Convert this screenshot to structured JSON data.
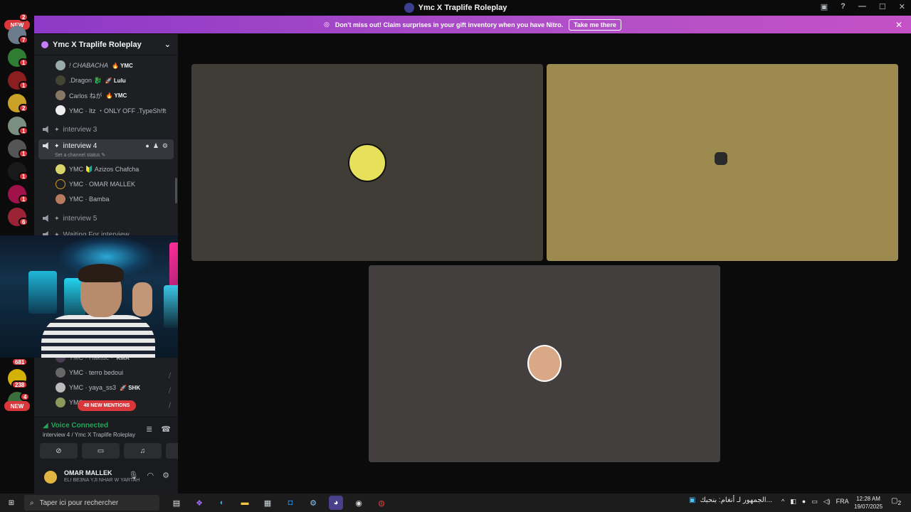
{
  "window": {
    "title": "Ymc X Traplife Roleplay",
    "help_icon": "?"
  },
  "nitro_banner": {
    "text": "Don't miss out! Claim surprises in your gift inventory when you have Nitro.",
    "button": "Take me there",
    "close": "✕"
  },
  "server_rail": {
    "top_new": "NEW",
    "badges": [
      "2",
      "7",
      "1",
      "1",
      "2",
      "1",
      "1",
      "1",
      "1",
      "6",
      "681",
      "238",
      "4"
    ],
    "bottom_new": "NEW"
  },
  "sidebar": {
    "server_name": "Ymc X Traplife Roleplay",
    "users_top": [
      {
        "name": "! CHABACHA",
        "tag": "🔥 YMC"
      },
      {
        "name": ".Dragon 🐉",
        "tag": "🚀 Lulu"
      },
      {
        "name": "Carlos ねが",
        "tag": "🔥 YMC"
      },
      {
        "name": "YMC · Itz ・ONLY OFF .TypeSh!ft",
        "tag": ""
      }
    ],
    "channels": [
      {
        "name": "interview 3"
      },
      {
        "name": "interview 4",
        "status": "Set a channel status ✎"
      },
      {
        "name": "interview 5"
      },
      {
        "name": "Waiting For interview"
      }
    ],
    "users_interview4": [
      {
        "name": "YMC 🔰 Azizos Chafcha"
      },
      {
        "name": "YMC · OMAR MALLEK"
      },
      {
        "name": "YMC · Bamba"
      }
    ],
    "users_bottom": [
      {
        "name": "YMC · Haktuc ·",
        "tag": "RMA"
      },
      {
        "name": "YMC · terro bedoui",
        "tag": ""
      },
      {
        "name": "YMC · yaya_ss3",
        "tag": "🚀 SHK"
      },
      {
        "name": "YMC",
        "tag": ""
      }
    ],
    "mentions_pill": "48 NEW MENTIONS"
  },
  "voice": {
    "title": "Voice Connected",
    "subtitle": "interview 4 / Ymc X Traplife Roleplay"
  },
  "user": {
    "name": "OMAR MALLEK",
    "status": "ELI BE3NA YJI NHAR W YARTAH"
  },
  "taskbar": {
    "search_placeholder": "Taper ici pour rechercher",
    "news": "الجمهور لـ أنغام: بنحبك...",
    "lang": "FRA",
    "time": "12:28 AM",
    "date": "19/07/2025",
    "notif_count": "2"
  },
  "colors": {
    "nitro_start": "#8d39c7",
    "nitro_end": "#c451c5",
    "voice_green": "#23a55a",
    "badge_red": "#da373c",
    "tile_1": "#3f3d35",
    "tile_2": "#9c8a4e",
    "tile_3": "#433f3e"
  }
}
